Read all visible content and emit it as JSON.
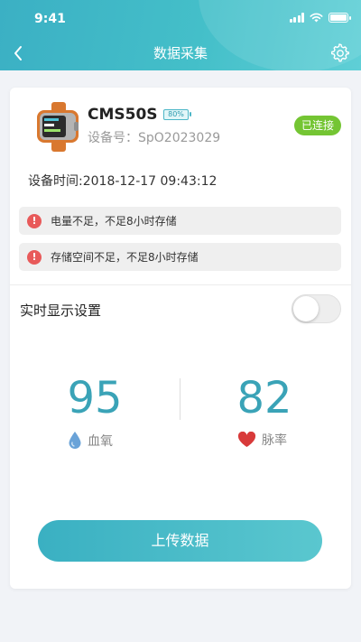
{
  "status_bar": {
    "time": "9:41"
  },
  "header": {
    "title": "数据采集"
  },
  "device": {
    "name": "CMS50S",
    "battery": "80%",
    "serial_label": "设备号：SpO2023029",
    "connection_status": "已连接"
  },
  "device_time": "设备时间:2018-12-17 09:43:12",
  "alerts": [
    {
      "icon": "!",
      "text": "电量不足，不足8小时存储"
    },
    {
      "icon": "!",
      "text": "存储空间不足，不足8小时存储"
    }
  ],
  "realtime": {
    "label": "实时显示设置",
    "enabled": false
  },
  "metrics": {
    "spo2": {
      "value": "95",
      "label": "血氧"
    },
    "pulse": {
      "value": "82",
      "label": "脉率"
    }
  },
  "upload_button": "上传数据",
  "colors": {
    "accent": "#3aa3b7",
    "connected": "#74c533",
    "alert": "#e85a5a",
    "heart": "#d83a3a",
    "drop": "#6aa3d8"
  }
}
